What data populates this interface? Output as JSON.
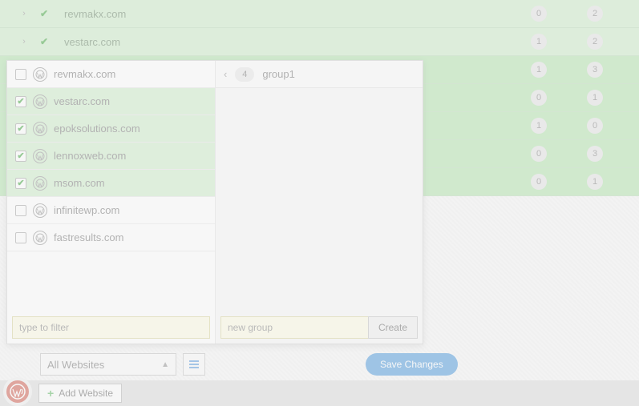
{
  "bg_rows": [
    {
      "site": "revmakx.com",
      "checked": true,
      "badges": [
        "0",
        "2"
      ]
    },
    {
      "site": "vestarc.com",
      "checked": true,
      "badges": [
        "1",
        "2"
      ]
    },
    {
      "site": "",
      "checked": false,
      "badges": [
        "1",
        "3"
      ]
    },
    {
      "site": "",
      "checked": false,
      "badges": [
        "0",
        "1"
      ]
    },
    {
      "site": "",
      "checked": false,
      "badges": [
        "1",
        "0"
      ]
    },
    {
      "site": "",
      "checked": false,
      "badges": [
        "0",
        "3"
      ]
    },
    {
      "site": "",
      "checked": false,
      "badges": [
        "0",
        "1"
      ]
    }
  ],
  "popup": {
    "sites": [
      {
        "name": "revmakx.com",
        "checked": false
      },
      {
        "name": "vestarc.com",
        "checked": true
      },
      {
        "name": "epoksolutions.com",
        "checked": true
      },
      {
        "name": "lennoxweb.com",
        "checked": true
      },
      {
        "name": "msom.com",
        "checked": true
      },
      {
        "name": "infinitewp.com",
        "checked": false
      },
      {
        "name": "fastresults.com",
        "checked": false
      }
    ],
    "filter_placeholder": "type to filter",
    "group_count": "4",
    "group_name": "group1",
    "new_group_placeholder": "new group",
    "create_label": "Create"
  },
  "bottom": {
    "dropdown_value": "All Websites",
    "save_label": "Save Changes"
  },
  "footer": {
    "add_label": "Add Website"
  }
}
